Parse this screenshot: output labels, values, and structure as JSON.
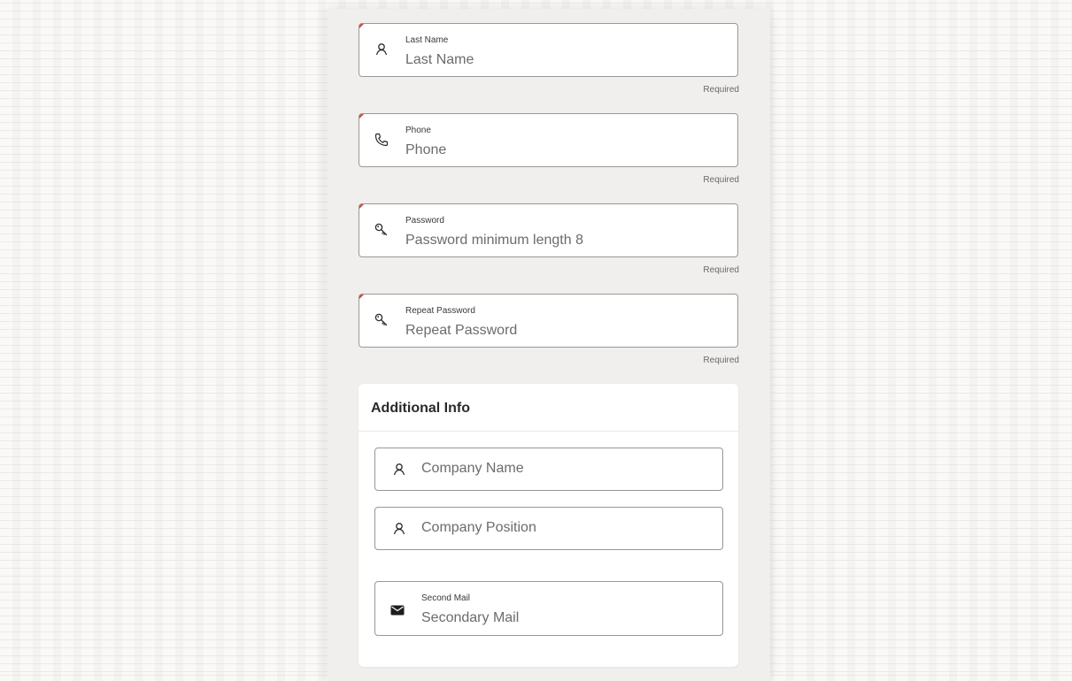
{
  "form": {
    "fields": [
      {
        "label": "Last Name",
        "placeholder": "Last Name",
        "helper": "Required",
        "icon": "person-icon"
      },
      {
        "label": "Phone",
        "placeholder": "Phone",
        "helper": "Required",
        "icon": "phone-icon"
      },
      {
        "label": "Password",
        "placeholder": "Password minimum length 8",
        "helper": "Required",
        "icon": "key-icon"
      },
      {
        "label": "Repeat Password",
        "placeholder": "Repeat Password",
        "helper": "Required",
        "icon": "key-icon"
      }
    ]
  },
  "additional_info": {
    "title": "Additional Info",
    "company_name": {
      "placeholder": "Company Name",
      "icon": "person-icon"
    },
    "company_position": {
      "placeholder": "Company Position",
      "icon": "person-icon"
    },
    "second_mail": {
      "label": "Second Mail",
      "placeholder": "Secondary Mail",
      "icon": "envelope-icon"
    }
  },
  "colors": {
    "required_accent": "#c74634",
    "panel_bg": "#f1efed",
    "border": "#9a9794"
  }
}
